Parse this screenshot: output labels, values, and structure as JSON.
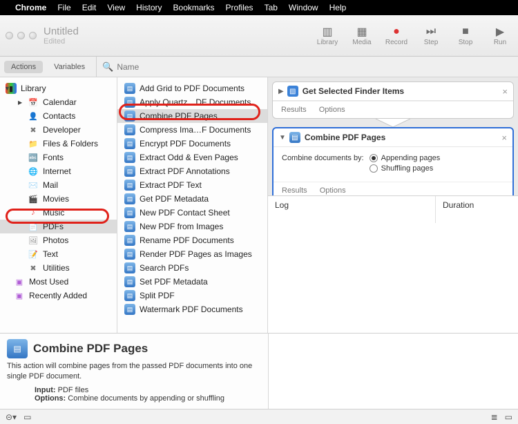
{
  "menubar": {
    "app": "Chrome",
    "items": [
      "File",
      "Edit",
      "View",
      "History",
      "Bookmarks",
      "Profiles",
      "Tab",
      "Window",
      "Help"
    ]
  },
  "window": {
    "title": "Untitled",
    "subtitle": "Edited"
  },
  "toolbar": {
    "library": "Library",
    "media": "Media",
    "record": "Record",
    "step": "Step",
    "stop": "Stop",
    "run": "Run"
  },
  "libswitch": {
    "actions": "Actions",
    "variables": "Variables",
    "search_placeholder": "Name"
  },
  "categories": {
    "root": "Library",
    "items": [
      {
        "label": "Calendar",
        "icon": "📅"
      },
      {
        "label": "Contacts",
        "icon": "👤"
      },
      {
        "label": "Developer",
        "icon": "✖︎"
      },
      {
        "label": "Files & Folders",
        "icon": "📁"
      },
      {
        "label": "Fonts",
        "icon": "🔤"
      },
      {
        "label": "Internet",
        "icon": "🌐"
      },
      {
        "label": "Mail",
        "icon": "✉️"
      },
      {
        "label": "Movies",
        "icon": "🎬"
      },
      {
        "label": "Music",
        "icon": "♪"
      },
      {
        "label": "PDFs",
        "icon": "📄",
        "selected": true
      },
      {
        "label": "Photos",
        "icon": "🖼"
      },
      {
        "label": "Text",
        "icon": "📝"
      },
      {
        "label": "Utilities",
        "icon": "✖︎"
      }
    ],
    "footer": [
      {
        "label": "Most Used"
      },
      {
        "label": "Recently Added"
      }
    ]
  },
  "actions": [
    "Add Grid to PDF Documents",
    "Apply Quartz…DF Documents",
    "Combine PDF Pages",
    "Compress Ima…F Documents",
    "Encrypt PDF Documents",
    "Extract Odd & Even Pages",
    "Extract PDF Annotations",
    "Extract PDF Text",
    "Get PDF Metadata",
    "New PDF Contact Sheet",
    "New PDF from Images",
    "Rename PDF Documents",
    "Render PDF Pages as Images",
    "Search PDFs",
    "Set PDF Metadata",
    "Split PDF",
    "Watermark PDF Documents"
  ],
  "actions_selected": 2,
  "workflow": {
    "step1": {
      "title": "Get Selected Finder Items",
      "results": "Results",
      "options": "Options"
    },
    "step2": {
      "title": "Combine PDF Pages",
      "prompt": "Combine documents by:",
      "opt_append": "Appending pages",
      "opt_shuffle": "Shuffling pages",
      "results": "Results",
      "options": "Options"
    }
  },
  "log": {
    "log": "Log",
    "duration": "Duration"
  },
  "info": {
    "title": "Combine PDF Pages",
    "desc": "This action will combine pages from the passed PDF documents into one single PDF document.",
    "input_k": "Input:",
    "input_v": " PDF files",
    "options_k": "Options:",
    "options_v": " Combine documents by appending or shuffling"
  }
}
